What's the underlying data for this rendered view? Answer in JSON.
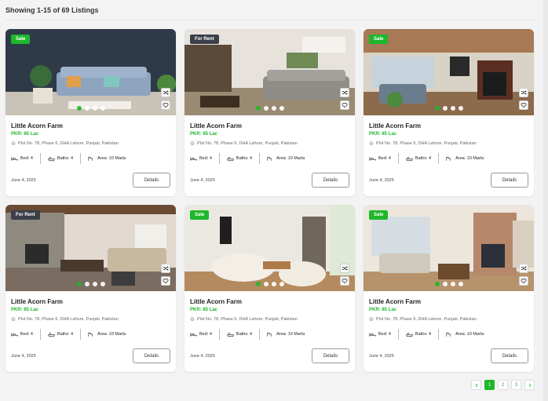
{
  "header": {
    "title": "Showing 1-15 of 69 Listings"
  },
  "listings": [
    {
      "badge": "Sale",
      "badge_type": "sale",
      "title": "Little Acorn Farm",
      "price": "PKR: 85 Lac",
      "address": "Plot No. 78, Phase 6, DHA Lahore, Punjab, Pakistan",
      "bed": "Bed: 4",
      "baths": "Baths: 4",
      "area": "Area: 10 Marla",
      "date": "June 4, 2025",
      "details_label": "Details",
      "slide_count": 4,
      "active_slide": 0
    },
    {
      "badge": "For Rent",
      "badge_type": "rent",
      "title": "Little Acorn Farm",
      "price": "PKR: 85 Lac",
      "address": "Plot No. 78, Phase 6, DHA Lahore, Punjab, Pakistan",
      "bed": "Bed: 4",
      "baths": "Baths: 4",
      "area": "Area: 10 Marla",
      "date": "June 4, 2025",
      "details_label": "Details",
      "slide_count": 4,
      "active_slide": 0
    },
    {
      "badge": "Sale",
      "badge_type": "sale",
      "title": "Little Acorn Farm",
      "price": "PKR: 85 Lac",
      "address": "Plot No. 78, Phase 6, DHA Lahore, Punjab, Pakistan",
      "bed": "Bed: 4",
      "baths": "Baths: 4",
      "area": "Area: 10 Marla",
      "date": "June 4, 2025",
      "details_label": "Details",
      "slide_count": 4,
      "active_slide": 0
    },
    {
      "badge": "For Rent",
      "badge_type": "rent",
      "title": "Little Acorn Farm",
      "price": "PKR: 85 Lac",
      "address": "Plot No. 78, Phase 6, DHA Lahore, Punjab, Pakistan",
      "bed": "Bed: 4",
      "baths": "Baths: 4",
      "area": "Area: 10 Marla",
      "date": "June 4, 2025",
      "details_label": "Details",
      "slide_count": 4,
      "active_slide": 0
    },
    {
      "badge": "Sale",
      "badge_type": "sale",
      "title": "Little Acorn Farm",
      "price": "PKR: 85 Lac",
      "address": "Plot No. 78, Phase 6, DHA Lahore, Punjab, Pakistan",
      "bed": "Bed: 4",
      "baths": "Baths: 4",
      "area": "Area: 10 Marla",
      "date": "June 4, 2025",
      "details_label": "Details",
      "slide_count": 4,
      "active_slide": 0
    },
    {
      "badge": "Sale",
      "badge_type": "sale",
      "title": "Little Acorn Farm",
      "price": "PKR: 85 Lac",
      "address": "Plot No. 78, Phase 6, DHA Lahore, Punjab, Pakistan",
      "bed": "Bed: 4",
      "baths": "Baths: 4",
      "area": "Area: 10 Marla",
      "date": "June 4, 2025",
      "details_label": "Details",
      "slide_count": 4,
      "active_slide": 0
    }
  ],
  "pagination": {
    "pages": [
      "1",
      "2",
      "3"
    ],
    "active_page": "1",
    "prev_icon": "chevron-left-icon",
    "next_icon": "chevron-right-icon"
  },
  "colors": {
    "accent": "#1db82a",
    "rent_badge": "#3a3f48"
  }
}
